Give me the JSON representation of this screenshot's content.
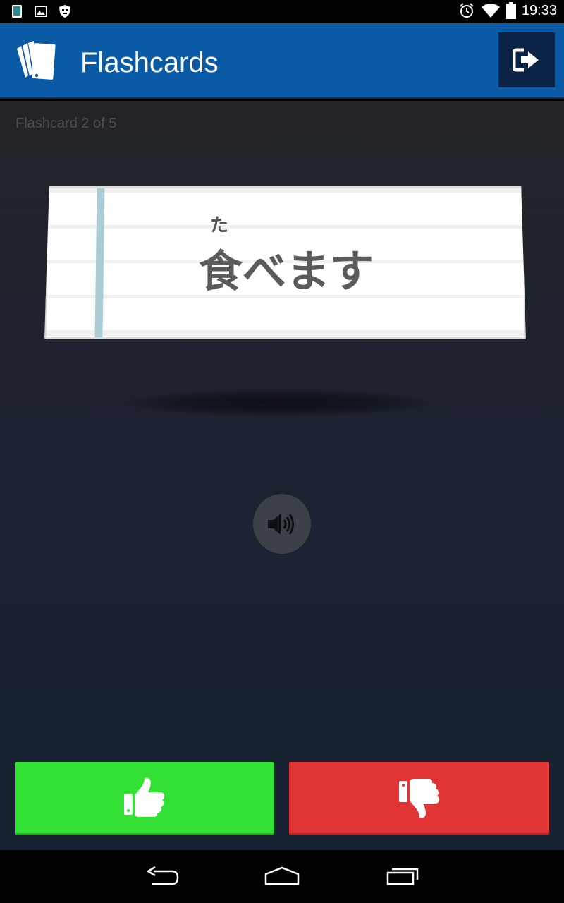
{
  "status_bar": {
    "time": "19:33",
    "left_icons": [
      "phone-icon",
      "image-icon",
      "shield-icon"
    ],
    "right_icons": [
      "alarm-icon",
      "wifi-icon",
      "battery-icon"
    ]
  },
  "app_bar": {
    "title": "Flashcards",
    "logo_icon": "cards-icon",
    "exit_icon": "exit-icon"
  },
  "main": {
    "counter": "Flashcard 2 of 5",
    "card": {
      "furigana": "た",
      "word": "食べます"
    },
    "audio_icon": "speaker-icon",
    "know_icon": "thumbs-up-icon",
    "dont_know_icon": "thumbs-down-icon"
  },
  "nav_bar": {
    "icons": [
      "back-icon",
      "home-icon",
      "recents-icon"
    ]
  },
  "colors": {
    "app_bar": "#0a5aa5",
    "know_button": "#33e034",
    "dont_know_button": "#e13434"
  }
}
